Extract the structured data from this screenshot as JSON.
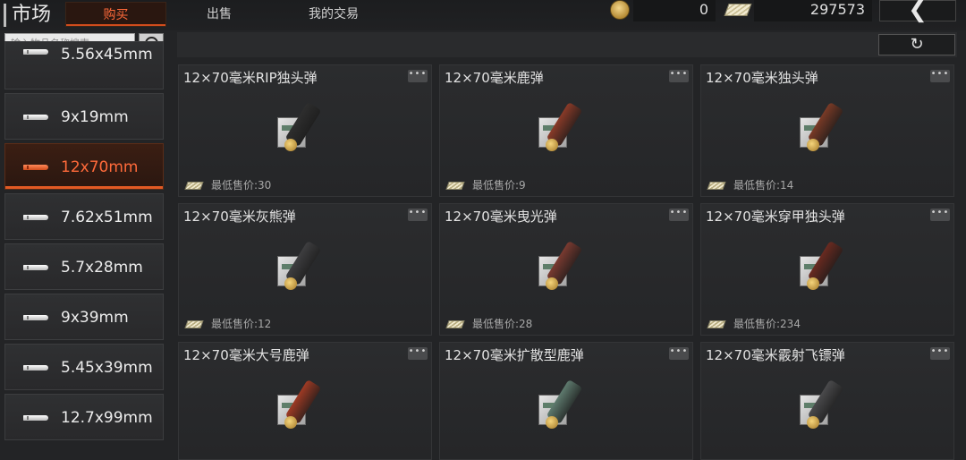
{
  "header": {
    "title": "市场",
    "tabs": [
      {
        "label": "购买",
        "active": true
      },
      {
        "label": "出售",
        "active": false
      },
      {
        "label": "我的交易",
        "active": false
      }
    ],
    "gold_balance": "0",
    "cash_balance": "297573",
    "back_icon": "chevron-left-icon",
    "refresh_icon": "refresh-icon"
  },
  "search": {
    "placeholder": "输入物品名称搜索"
  },
  "categories": [
    {
      "label": "5.56x45mm",
      "active": false
    },
    {
      "label": "9x19mm",
      "active": false
    },
    {
      "label": "12x70mm",
      "active": true
    },
    {
      "label": "7.62x51mm",
      "active": false
    },
    {
      "label": "5.7x28mm",
      "active": false
    },
    {
      "label": "9x39mm",
      "active": false
    },
    {
      "label": "5.45x39mm",
      "active": false
    },
    {
      "label": "12.7x99mm",
      "active": false
    }
  ],
  "items": [
    {
      "name": "12×70毫米RIP独头弹",
      "price": "最低售价:30",
      "shell_color": "#2e2e2e"
    },
    {
      "name": "12×70毫米鹿弹",
      "price": "最低售价:9",
      "shell_color": "#8a3a28"
    },
    {
      "name": "12×70毫米独头弹",
      "price": "最低售价:14",
      "shell_color": "#7a3a26"
    },
    {
      "name": "12×70毫米灰熊弹",
      "price": "最低售价:12",
      "shell_color": "#3e3e40"
    },
    {
      "name": "12×70毫米曳光弹",
      "price": "最低售价:28",
      "shell_color": "#7a3a30"
    },
    {
      "name": "12×70毫米穿甲独头弹",
      "price": "最低售价:234",
      "shell_color": "#6a2a20"
    },
    {
      "name": "12×70毫米大号鹿弹",
      "price": "",
      "shell_color": "#9e3a24"
    },
    {
      "name": "12×70毫米扩散型鹿弹",
      "price": "",
      "shell_color": "#5e7a6e"
    },
    {
      "name": "12×70毫米霰射飞镖弹",
      "price": "",
      "shell_color": "#4a4a4c"
    }
  ],
  "more_label": "•••"
}
